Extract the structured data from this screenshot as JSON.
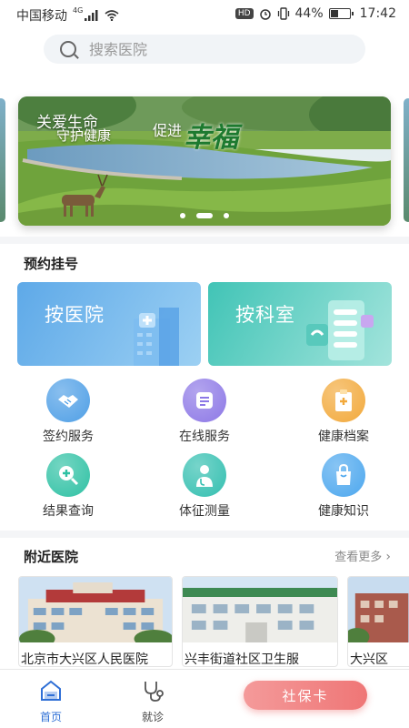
{
  "status_bar": {
    "carrier": "中国移动",
    "network": "4G",
    "hd": "HD",
    "battery": "44%",
    "battery_level": 0.44,
    "time": "17:42"
  },
  "search": {
    "placeholder": "搜索医院"
  },
  "banner": {
    "line1": "关爱生命",
    "line2": "守护健康",
    "line3": "促进",
    "calligraphy": "幸福",
    "slides": 3,
    "active_slide": 2
  },
  "appointment": {
    "title": "预约挂号",
    "by_hospital": "按医院",
    "by_department": "按科室"
  },
  "services": [
    {
      "label": "签约服务",
      "icon": "handshake-icon",
      "color": "#4f9fe6"
    },
    {
      "label": "在线服务",
      "icon": "doctor-online-icon",
      "color": "#8d78e6"
    },
    {
      "label": "健康档案",
      "icon": "clipboard-icon",
      "color": "#f2a93b"
    },
    {
      "label": "结果查询",
      "icon": "search-plus-icon",
      "color": "#2fc1a4"
    },
    {
      "label": "体征测量",
      "icon": "stethoscope-doctor-icon",
      "color": "#33bfb0"
    },
    {
      "label": "健康知识",
      "icon": "bag-icon",
      "color": "#4ca7ee"
    }
  ],
  "nearby": {
    "title": "附近医院",
    "more": "查看更多",
    "hospitals": [
      {
        "name": "北京市大兴区人民医院"
      },
      {
        "name": "兴丰街道社区卫生服"
      },
      {
        "name": "大兴区"
      }
    ]
  },
  "tabbar": {
    "home": "首页",
    "visit": "就诊",
    "action": "社保卡"
  }
}
